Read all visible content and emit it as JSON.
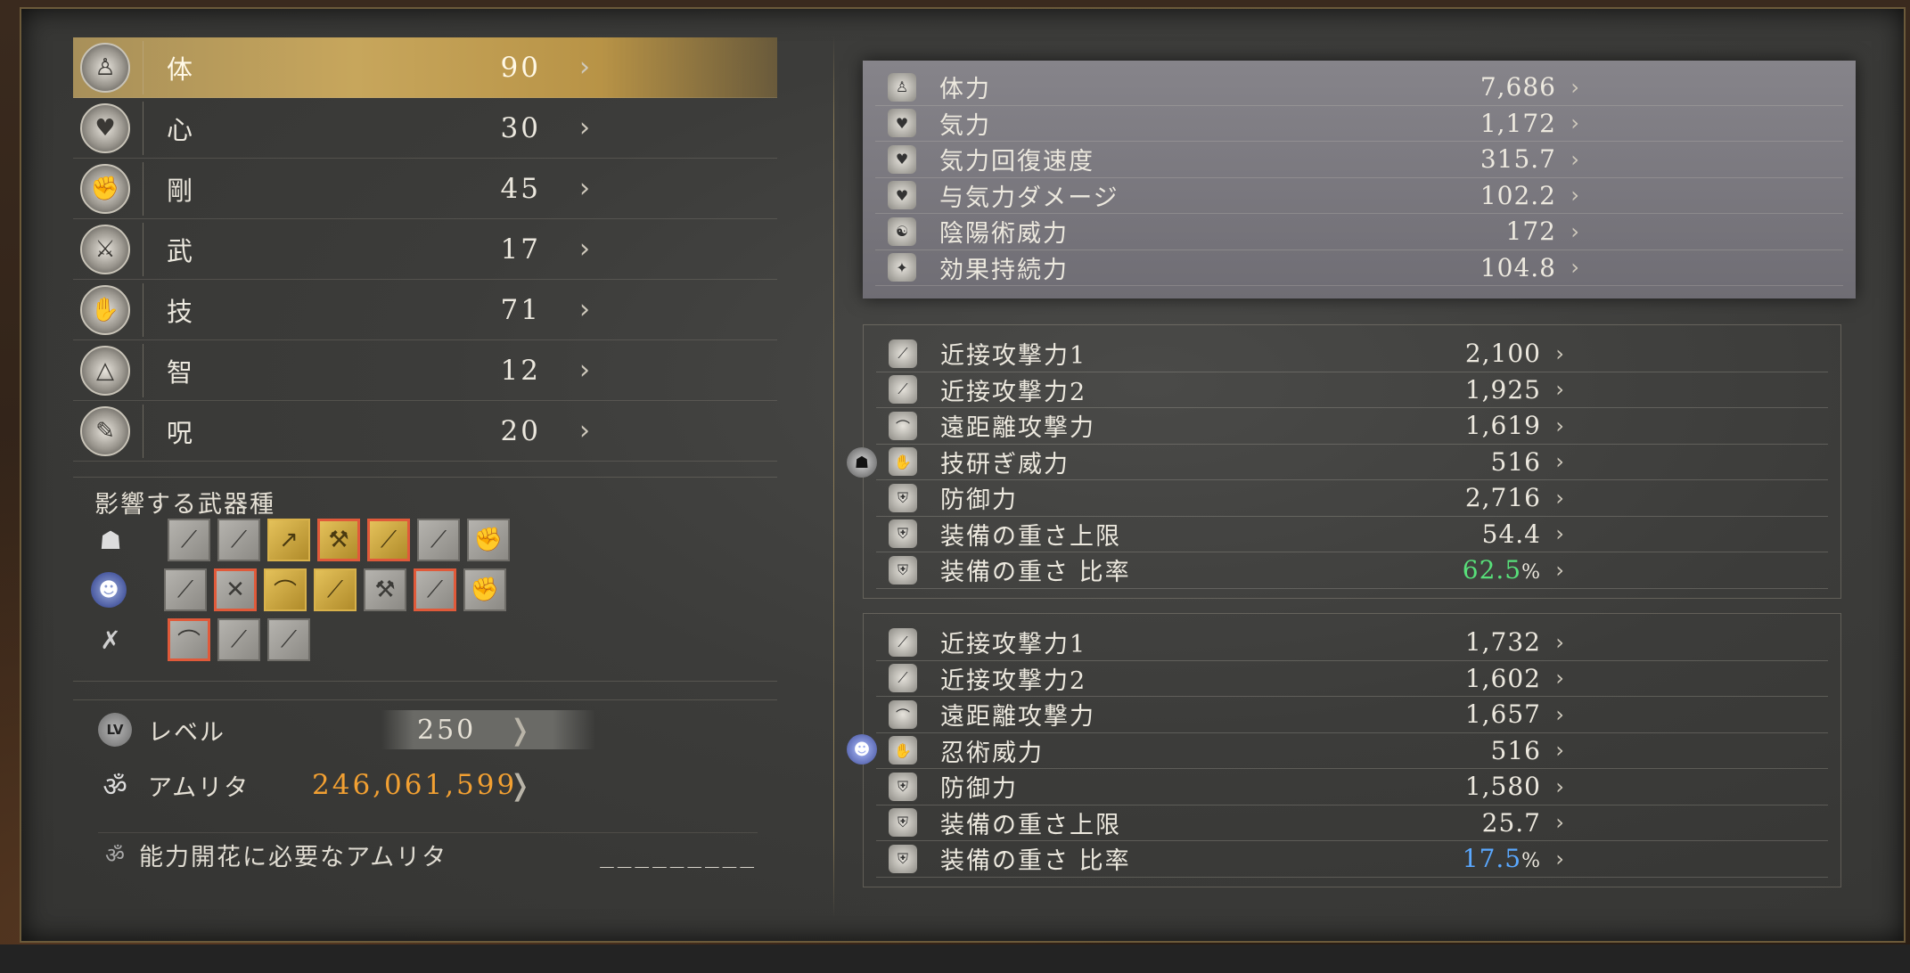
{
  "attributes": [
    {
      "name": "体",
      "value": "90",
      "icon": "body-icon",
      "glyph": "♙",
      "selected": true
    },
    {
      "name": "心",
      "value": "30",
      "icon": "heart-icon",
      "glyph": "♥",
      "selected": false
    },
    {
      "name": "剛",
      "value": "45",
      "icon": "strength-icon",
      "glyph": "✊",
      "selected": false
    },
    {
      "name": "武",
      "value": "17",
      "icon": "stamina-icon",
      "glyph": "⚔",
      "selected": false
    },
    {
      "name": "技",
      "value": "71",
      "icon": "skill-icon",
      "glyph": "✋",
      "selected": false
    },
    {
      "name": "智",
      "value": "12",
      "icon": "dexterity-icon",
      "glyph": "△",
      "selected": false
    },
    {
      "name": "呪",
      "value": "20",
      "icon": "magic-icon",
      "glyph": "✎",
      "selected": false
    }
  ],
  "weapons": {
    "title": "影響する武器種",
    "rows": [
      {
        "lead_icon": "samurai-icon",
        "lead_glyph": "☗",
        "lead_class": "samurai",
        "items": [
          {
            "icon": "katana-icon",
            "glyph": "⟋",
            "state": ""
          },
          {
            "icon": "dual-sword-icon",
            "glyph": "⟋",
            "state": ""
          },
          {
            "icon": "spear-icon",
            "glyph": "↗",
            "state": "gold"
          },
          {
            "icon": "axe-icon",
            "glyph": "⚒",
            "state": "gold red"
          },
          {
            "icon": "odachi-icon",
            "glyph": "⟋",
            "state": "gold red"
          },
          {
            "icon": "kusarigama-icon",
            "glyph": "⟋",
            "state": ""
          },
          {
            "icon": "tonfa-icon",
            "glyph": "✊",
            "state": ""
          }
        ]
      },
      {
        "lead_icon": "ninja-icon",
        "lead_glyph": "☻",
        "lead_class": "ninja",
        "items": [
          {
            "icon": "tachi-icon",
            "glyph": "⟋",
            "state": ""
          },
          {
            "icon": "switchglaive-icon",
            "glyph": "✕",
            "state": "red"
          },
          {
            "icon": "kusarigama-icon",
            "glyph": "⌒",
            "state": "gold"
          },
          {
            "icon": "odachi-icon",
            "glyph": "⟋",
            "state": "gold"
          },
          {
            "icon": "hatchets-icon",
            "glyph": "⚒",
            "state": ""
          },
          {
            "icon": "splitstaff-icon",
            "glyph": "⟋",
            "state": "red"
          },
          {
            "icon": "fists-icon",
            "glyph": "✊",
            "state": ""
          }
        ]
      },
      {
        "lead_icon": "bow-icon",
        "lead_glyph": "✗",
        "lead_class": "bow",
        "items": [
          {
            "icon": "bow-weapon-icon",
            "glyph": "⌒",
            "state": "red"
          },
          {
            "icon": "rifle-icon",
            "glyph": "⟋",
            "state": ""
          },
          {
            "icon": "hand-cannon-icon",
            "glyph": "⟋",
            "state": ""
          }
        ]
      }
    ]
  },
  "level": {
    "label": "レベル",
    "badge": "LV",
    "value": "250"
  },
  "amrita": {
    "label": "アムリタ",
    "value": "246,061,599"
  },
  "required": {
    "label": "能力開花に必要なアムリタ",
    "value": "_________"
  },
  "general_stats": [
    {
      "name": "体力",
      "value": "7,686",
      "glyph": "♙"
    },
    {
      "name": "気力",
      "value": "1,172",
      "glyph": "♥"
    },
    {
      "name": "気力回復速度",
      "value": "315.7",
      "glyph": "♥"
    },
    {
      "name": "与気力ダメージ",
      "value": "102.2",
      "glyph": "♥"
    },
    {
      "name": "陰陽術威力",
      "value": "172",
      "glyph": "☯"
    },
    {
      "name": "効果持続力",
      "value": "104.8",
      "glyph": "✦"
    }
  ],
  "samurai_stats": [
    {
      "name": "近接攻撃力1",
      "value": "2,100",
      "glyph": "⟋"
    },
    {
      "name": "近接攻撃力2",
      "value": "1,925",
      "glyph": "⟋"
    },
    {
      "name": "遠距離攻撃力",
      "value": "1,619",
      "glyph": "⌒"
    },
    {
      "name": "技研ぎ威力",
      "value": "516",
      "glyph": "✋"
    },
    {
      "name": "防御力",
      "value": "2,716",
      "glyph": "⛨"
    },
    {
      "name": "装備の重さ上限",
      "value": "54.4",
      "glyph": "⛨"
    },
    {
      "name": "装備の重さ 比率",
      "value": "62.5",
      "unit": "%",
      "color": "green",
      "glyph": "⛨"
    }
  ],
  "ninja_stats": [
    {
      "name": "近接攻撃力1",
      "value": "1,732",
      "glyph": "⟋"
    },
    {
      "name": "近接攻撃力2",
      "value": "1,602",
      "glyph": "⟋"
    },
    {
      "name": "遠距離攻撃力",
      "value": "1,657",
      "glyph": "⌒"
    },
    {
      "name": "忍術威力",
      "value": "516",
      "glyph": "✋"
    },
    {
      "name": "防御力",
      "value": "1,580",
      "glyph": "⛨"
    },
    {
      "name": "装備の重さ上限",
      "value": "25.7",
      "glyph": "⛨"
    },
    {
      "name": "装備の重さ 比率",
      "value": "17.5",
      "unit": "%",
      "color": "blue",
      "glyph": "⛨"
    }
  ],
  "arrow_glyph": "›",
  "big_arrow_glyph": "❭"
}
